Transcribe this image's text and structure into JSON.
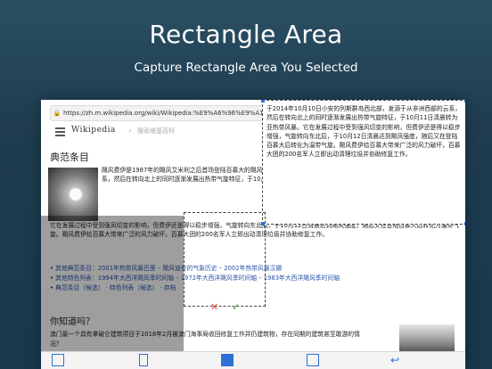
{
  "hero": {
    "title": "Rectangle Area",
    "subtitle": "Capture Rectangle Area You Selected"
  },
  "browser": {
    "url": "https://zh.m.wikipedia.org/wiki/Wikipedia:%E9%A6%96%E9%A1%B5"
  },
  "wiki": {
    "logo": "Wikipedia",
    "search_placeholder": "搜索维基百科",
    "section_featured": "典范条目",
    "featured_text_1": "飓风费伊是1987年的飓风艾米利之后首场登陆百慕大的飓风，于2014年10月10日小安的列斯群岛西北部发源于从非洲西部",
    "featured_text_2": "的云系，然后在转向北上的同时逐渐发展出热带气旋特征，于10月11日清晨转为亚热带风暴。",
    "featured_text_full": "它在发展过程中受到强风切变的影响，但费伊还是得以稳步增强，气旋转向东北后，于10月12日清晨达到飓风强度，随后又在登陆百慕大后转化为温带气旋。飓风费伊给百慕大带来广泛的风力破坏，百慕大团的200名军人立即出动清理垃圾并协助修复工作。",
    "bullets": [
      "其他典范条目：2001年热带风暴巴里 – 飓风迪安的气象历史 – 2002年热带风暴汉娜",
      "其他特色列表：1994年大西洋飓风季时间轴 – 1972年大西洋飓风季时间轴 – 1983年大西洋飓风季时间轴",
      "典范条目（候选） · 特色列表（候选） · 存档"
    ],
    "section_dyk": "你知道吗？",
    "dyk_text": "澳门最一个具有拿破仑建筑项目于2018年2月被澳门海事局收回修复工作并仍建筑物，存在同期的建筑甚至敢游的情况？"
  },
  "selection": {
    "text": "于2014年10月10日小安的列斯群岛西北部，发源于从非洲西部的云系，然后在转向北上的同时逐渐发展出热带气旋特征，于10月11日清晨转为亚热带风暴。它在发展过程中受到强风切变的影响，但费伊还是得以稳步增强，气旋转向东北后，于10月12日清晨达到飓风强度，随后又在登陆百慕大后转化为温带气旋。飓风费伊给百慕大带来广泛的风力破坏，百慕大团的200名军人立即出动清理垃圾并协助修复工作。"
  },
  "colors": {
    "accent": "#2e6fd8",
    "cancel": "#e04b3c",
    "confirm": "#43a047"
  },
  "toolbar": {
    "icons": [
      "full-page-icon",
      "document-icon",
      "rectangle-capture-icon",
      "scroll-capture-icon",
      "undo-icon"
    ]
  }
}
